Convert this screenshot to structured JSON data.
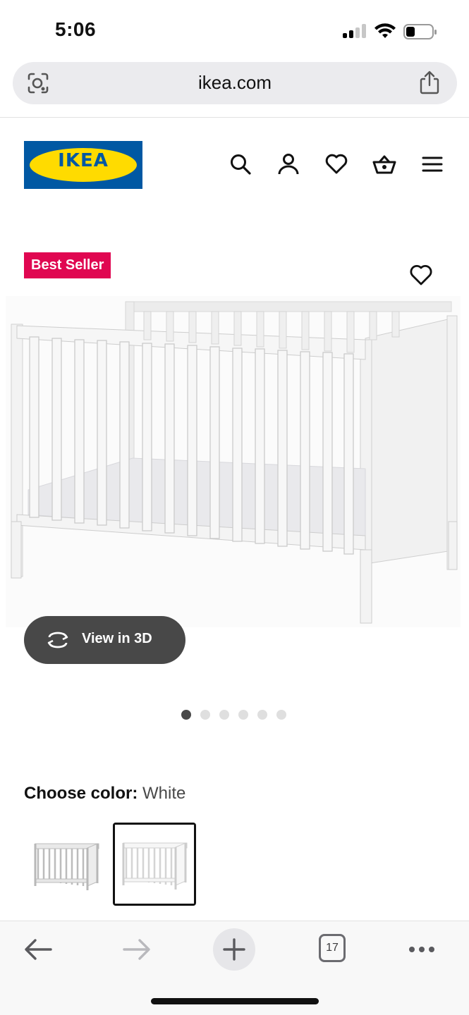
{
  "status_bar": {
    "time": "5:06",
    "battery_level": 0.3
  },
  "browser": {
    "url": "ikea.com",
    "tab_count": "17"
  },
  "header": {
    "logo_text": "IKEA",
    "brand_colors": {
      "blue": "#0058a3",
      "yellow": "#ffdb00"
    }
  },
  "nav_icons": [
    "search-icon",
    "account-icon",
    "favorites-icon",
    "basket-icon",
    "menu-icon"
  ],
  "product": {
    "badge": "Best Seller",
    "badge_color": "#e00751",
    "view_3d_label": "View in 3D",
    "image_count": 6,
    "active_image_index": 0,
    "color_label": "Choose color:",
    "color_value": "White",
    "swatches": [
      {
        "name": "Grey",
        "selected": false
      },
      {
        "name": "White",
        "selected": true
      }
    ]
  },
  "toolbar_icons": [
    "back-icon",
    "forward-icon",
    "new-tab-icon",
    "tabs-icon",
    "more-icon"
  ]
}
